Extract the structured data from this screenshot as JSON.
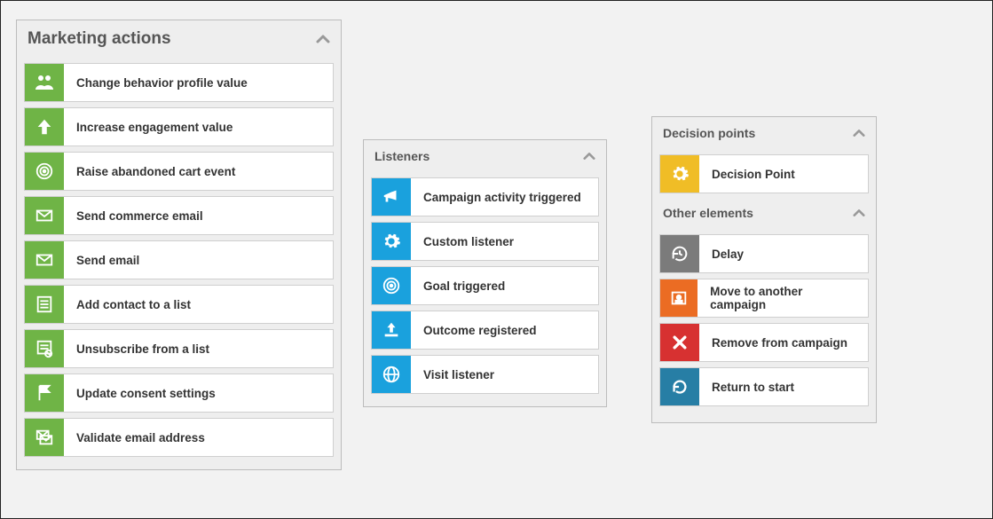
{
  "marketing_actions": {
    "title": "Marketing actions",
    "items": [
      {
        "label": "Change behavior profile value"
      },
      {
        "label": "Increase engagement value"
      },
      {
        "label": "Raise abandoned cart event"
      },
      {
        "label": "Send commerce email"
      },
      {
        "label": "Send email"
      },
      {
        "label": "Add contact to a list"
      },
      {
        "label": "Unsubscribe from a list"
      },
      {
        "label": "Update consent settings"
      },
      {
        "label": "Validate email address"
      }
    ]
  },
  "listeners": {
    "title": "Listeners",
    "items": [
      {
        "label": "Campaign activity triggered"
      },
      {
        "label": "Custom listener"
      },
      {
        "label": "Goal triggered"
      },
      {
        "label": "Outcome registered"
      },
      {
        "label": "Visit listener"
      }
    ]
  },
  "decision_points": {
    "title": "Decision points",
    "items": [
      {
        "label": "Decision Point"
      }
    ]
  },
  "other_elements": {
    "title": "Other elements",
    "items": [
      {
        "label": "Delay"
      },
      {
        "label": "Move to another campaign"
      },
      {
        "label": "Remove from campaign"
      },
      {
        "label": "Return to start"
      }
    ]
  }
}
